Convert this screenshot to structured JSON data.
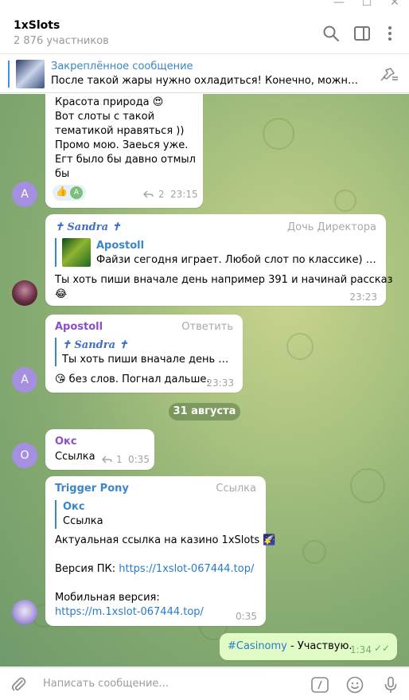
{
  "window": {
    "minimize": "—",
    "maximize": "☐",
    "close": "✕"
  },
  "header": {
    "title": "1xSlots",
    "subtitle": "2 876 участников"
  },
  "pinned": {
    "title": "Закреплённое сообщение",
    "text": "После такой жары нужно охладиться! Конечно, можно подо..."
  },
  "messages": {
    "m1": {
      "lines": [
        "Красота природа 😍",
        "Вот слоты с такой",
        "тематикой нравяться ))",
        "Промо мою. Заеься уже.",
        "Егт было бы давно отмыл",
        "бы"
      ],
      "reaction": "👍",
      "reaction_avatar": "A",
      "replies": "2",
      "time": "23:15",
      "avatar": "A"
    },
    "m2": {
      "sender": "✝ Sandra ✝",
      "role": "Дочь Директора",
      "reply_name": "Apostoll",
      "reply_text": "Файзи сегодня играет. Любой слот по классике) и унди...",
      "text": "Ты хоть пиши вначале день например 391 и начинай рассказ",
      "emoji": "😂",
      "time": "23:23"
    },
    "m3": {
      "sender": "Apostoll",
      "role": "Ответить",
      "reply_name": "✝ Sandra ✝",
      "reply_text": "Ты хоть пиши вначале день нап...",
      "text": "😘 без слов.  Погнал дальше.",
      "time": "23:33",
      "avatar": "A"
    },
    "date": "31 августа",
    "m4": {
      "sender": "Окс",
      "text": "Ссылка",
      "replies": "1",
      "time": "0:35",
      "avatar": "O"
    },
    "m5": {
      "sender": "Trigger Pony",
      "role": "Ссылка",
      "reply_name": "Окс",
      "reply_text": "Ссылка",
      "line1": "Актуальная ссылка на казино 1xSlots 🌠",
      "pc_label": "Версия ПК: ",
      "pc_link": "https://1xslot-067444.top/",
      "mobile_label": "Мобильная версия:",
      "mobile_link": "https://m.1xslot-067444.top/",
      "time": "0:35"
    },
    "m6": {
      "hashtag": "#Casinomy",
      "text": " - Участвую.",
      "time": "1:34",
      "ticks": "✓✓"
    }
  },
  "input": {
    "placeholder": "Написать сообщение..."
  },
  "colors": {
    "accent": "#3a86c8",
    "outgoing": "#e1fbc6",
    "link": "#2a7bc5"
  }
}
